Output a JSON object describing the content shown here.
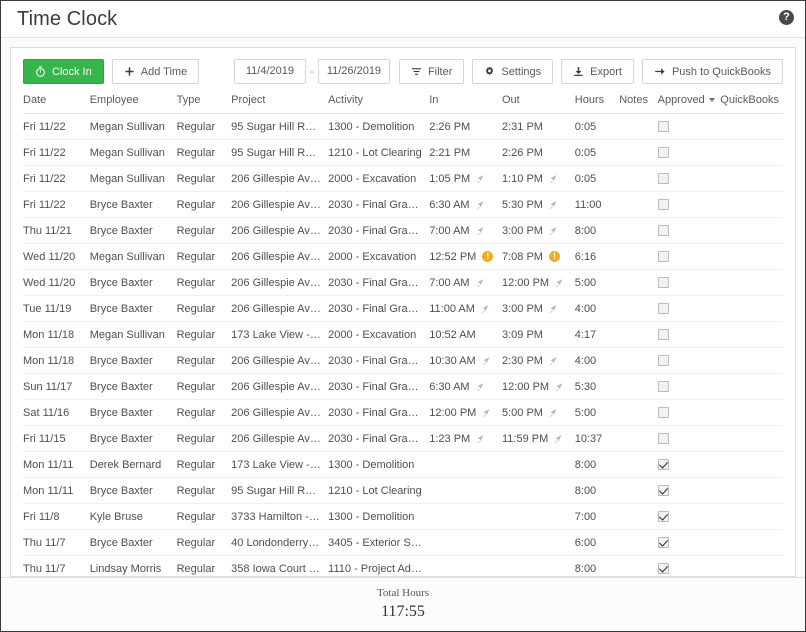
{
  "header": {
    "title": "Time Clock",
    "help_icon": "question-mark-circle-icon"
  },
  "toolbar": {
    "clock_in_label": "Clock In",
    "clock_in_icon": "stopwatch-icon",
    "clock_in_color": "#37b44a",
    "add_time_label": "Add Time",
    "add_time_icon": "plus-icon",
    "date_from": "11/4/2019",
    "date_separator": "-",
    "date_to": "11/26/2019",
    "filter_label": "Filter",
    "filter_icon": "filter-icon",
    "settings_label": "Settings",
    "settings_icon": "gear-icon",
    "export_label": "Export",
    "export_icon": "download-icon",
    "push_label": "Push to QuickBooks",
    "push_icon": "arrow-right-icon"
  },
  "table": {
    "columns": [
      "Date",
      "Employee",
      "Type",
      "Project",
      "Activity",
      "In",
      "Out",
      "Hours",
      "Notes",
      "Approved",
      "QuickBooks"
    ],
    "approved_sort_icon": "chevron-down-icon",
    "rows": [
      {
        "date": "Fri 11/22",
        "employee": "Megan Sullivan",
        "type": "Regular",
        "project": "95 Sugar Hill Rd. - ...",
        "activity": "1300 - Demolition",
        "in": "2:26 PM",
        "in_icon": "",
        "out": "2:31 PM",
        "out_icon": "",
        "hours": "0:05",
        "notes": "",
        "approved": false,
        "quickbooks": ""
      },
      {
        "date": "Fri 11/22",
        "employee": "Megan Sullivan",
        "type": "Regular",
        "project": "95 Sugar Hill Rd. - ...",
        "activity": "1210 - Lot Clearing",
        "in": "2:21 PM",
        "in_icon": "",
        "out": "2:26 PM",
        "out_icon": "",
        "hours": "0:05",
        "notes": "",
        "approved": false,
        "quickbooks": ""
      },
      {
        "date": "Fri 11/22",
        "employee": "Megan Sullivan",
        "type": "Regular",
        "project": "206 Gillespie Ave - ...",
        "activity": "2000 - Excavation",
        "in": "1:05 PM",
        "in_icon": "location-icon",
        "out": "1:10 PM",
        "out_icon": "location-icon",
        "hours": "0:05",
        "notes": "",
        "approved": false,
        "quickbooks": ""
      },
      {
        "date": "Fri 11/22",
        "employee": "Bryce Baxter",
        "type": "Regular",
        "project": "206 Gillespie Ave - ...",
        "activity": "2030 - Final Grading",
        "in": "6:30 AM",
        "in_icon": "location-icon",
        "out": "5:30 PM",
        "out_icon": "location-icon",
        "hours": "11:00",
        "notes": "",
        "approved": false,
        "quickbooks": ""
      },
      {
        "date": "Thu 11/21",
        "employee": "Bryce Baxter",
        "type": "Regular",
        "project": "206 Gillespie Ave - ...",
        "activity": "2030 - Final Grading",
        "in": "7:00 AM",
        "in_icon": "location-icon",
        "out": "3:00 PM",
        "out_icon": "location-icon",
        "hours": "8:00",
        "notes": "",
        "approved": false,
        "quickbooks": ""
      },
      {
        "date": "Wed 11/20",
        "employee": "Megan Sullivan",
        "type": "Regular",
        "project": "206 Gillespie Ave - ...",
        "activity": "2000 - Excavation",
        "in": "12:52 PM",
        "in_icon": "warning-icon",
        "out": "7:08 PM",
        "out_icon": "warning-icon",
        "hours": "6:16",
        "notes": "",
        "approved": false,
        "quickbooks": ""
      },
      {
        "date": "Wed 11/20",
        "employee": "Bryce Baxter",
        "type": "Regular",
        "project": "206 Gillespie Ave - ...",
        "activity": "2030 - Final Grading",
        "in": "7:00 AM",
        "in_icon": "location-icon",
        "out": "12:00 PM",
        "out_icon": "location-icon",
        "hours": "5:00",
        "notes": "",
        "approved": false,
        "quickbooks": ""
      },
      {
        "date": "Tue 11/19",
        "employee": "Bryce Baxter",
        "type": "Regular",
        "project": "206 Gillespie Ave - ...",
        "activity": "2030 - Final Grading",
        "in": "11:00 AM",
        "in_icon": "location-icon",
        "out": "3:00 PM",
        "out_icon": "location-icon",
        "hours": "4:00",
        "notes": "",
        "approved": false,
        "quickbooks": ""
      },
      {
        "date": "Mon 11/18",
        "employee": "Megan Sullivan",
        "type": "Regular",
        "project": "173 Lake View - Gol...",
        "activity": "2000 - Excavation",
        "in": "10:52 AM",
        "in_icon": "",
        "out": "3:09 PM",
        "out_icon": "",
        "hours": "4:17",
        "notes": "",
        "approved": false,
        "quickbooks": ""
      },
      {
        "date": "Mon 11/18",
        "employee": "Bryce Baxter",
        "type": "Regular",
        "project": "206 Gillespie Ave - ...",
        "activity": "2030 - Final Grading",
        "in": "10:30 AM",
        "in_icon": "location-icon",
        "out": "2:30 PM",
        "out_icon": "location-icon",
        "hours": "4:00",
        "notes": "",
        "approved": false,
        "quickbooks": ""
      },
      {
        "date": "Sun 11/17",
        "employee": "Bryce Baxter",
        "type": "Regular",
        "project": "206 Gillespie Ave - ...",
        "activity": "2030 - Final Grading",
        "in": "6:30 AM",
        "in_icon": "location-icon",
        "out": "12:00 PM",
        "out_icon": "location-icon",
        "hours": "5:30",
        "notes": "",
        "approved": false,
        "quickbooks": ""
      },
      {
        "date": "Sat 11/16",
        "employee": "Bryce Baxter",
        "type": "Regular",
        "project": "206 Gillespie Ave - ...",
        "activity": "2030 - Final Grading",
        "in": "12:00 PM",
        "in_icon": "location-icon",
        "out": "5:00 PM",
        "out_icon": "location-icon",
        "hours": "5:00",
        "notes": "",
        "approved": false,
        "quickbooks": ""
      },
      {
        "date": "Fri 11/15",
        "employee": "Bryce Baxter",
        "type": "Regular",
        "project": "206 Gillespie Ave - ...",
        "activity": "2030 - Final Grading",
        "in": "1:23 PM",
        "in_icon": "location-icon",
        "out": "11:59 PM",
        "out_icon": "location-icon",
        "hours": "10:37",
        "notes": "",
        "approved": false,
        "quickbooks": ""
      },
      {
        "date": "Mon 11/11",
        "employee": "Derek Bernard",
        "type": "Regular",
        "project": "173 Lake View - Gol...",
        "activity": "1300 - Demolition",
        "in": "",
        "in_icon": "",
        "out": "",
        "out_icon": "",
        "hours": "8:00",
        "notes": "",
        "approved": true,
        "quickbooks": ""
      },
      {
        "date": "Mon 11/11",
        "employee": "Bryce Baxter",
        "type": "Regular",
        "project": "95 Sugar Hill Rd. - ...",
        "activity": "1210 - Lot Clearing",
        "in": "",
        "in_icon": "",
        "out": "",
        "out_icon": "",
        "hours": "8:00",
        "notes": "",
        "approved": true,
        "quickbooks": ""
      },
      {
        "date": "Fri 11/8",
        "employee": "Kyle Bruse",
        "type": "Regular",
        "project": "3733 Hamilton - Ge...",
        "activity": "1300 - Demolition",
        "in": "",
        "in_icon": "",
        "out": "",
        "out_icon": "",
        "hours": "7:00",
        "notes": "",
        "approved": true,
        "quickbooks": ""
      },
      {
        "date": "Thu 11/7",
        "employee": "Bryce Baxter",
        "type": "Regular",
        "project": "40 Londonderry - M...",
        "activity": "3405 - Exterior Sidi...",
        "in": "",
        "in_icon": "",
        "out": "",
        "out_icon": "",
        "hours": "6:00",
        "notes": "",
        "approved": true,
        "quickbooks": ""
      },
      {
        "date": "Thu 11/7",
        "employee": "Lindsay Morris",
        "type": "Regular",
        "project": "358 Iowa Court - W...",
        "activity": "1110 - Project Admi...",
        "in": "",
        "in_icon": "",
        "out": "",
        "out_icon": "",
        "hours": "8:00",
        "notes": "",
        "approved": true,
        "quickbooks": ""
      }
    ]
  },
  "footer": {
    "total_label": "Total Hours",
    "total_value": "117:55"
  }
}
